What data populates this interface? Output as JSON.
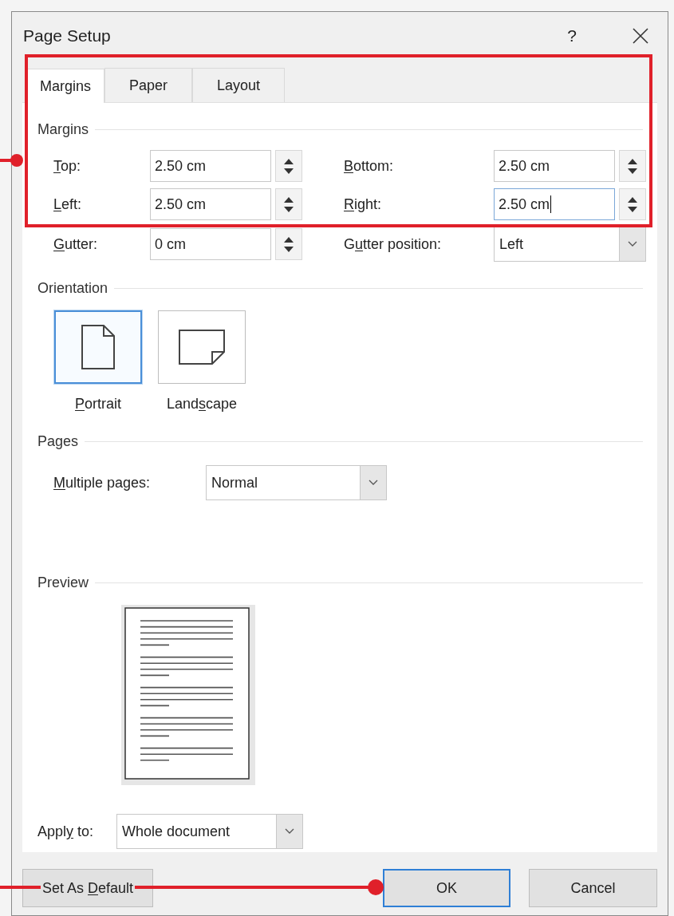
{
  "window": {
    "title": "Page Setup",
    "help": "?"
  },
  "tabs": [
    {
      "label": "Margins",
      "selected": true
    },
    {
      "label": "Paper",
      "selected": false
    },
    {
      "label": "Layout",
      "selected": false
    }
  ],
  "margins": {
    "heading": "Margins",
    "rows": [
      {
        "left": {
          "label": [
            {
              "text": "T",
              "underline": true
            },
            {
              "text": "op:",
              "underline": false
            }
          ],
          "value": "2.50 cm",
          "kind": "spin",
          "focused": false
        },
        "right": {
          "label": [
            {
              "text": "B",
              "underline": true
            },
            {
              "text": "ottom:",
              "underline": false
            }
          ],
          "value": "2.50 cm",
          "kind": "spin",
          "focused": false
        }
      },
      {
        "left": {
          "label": [
            {
              "text": "L",
              "underline": true
            },
            {
              "text": "eft:",
              "underline": false
            }
          ],
          "value": "2.50 cm",
          "kind": "spin",
          "focused": false
        },
        "right": {
          "label": [
            {
              "text": "R",
              "underline": true
            },
            {
              "text": "ight:",
              "underline": false
            }
          ],
          "value": "2.50 cm",
          "kind": "spin",
          "focused": true
        }
      },
      {
        "left": {
          "label": [
            {
              "text": "G",
              "underline": true
            },
            {
              "text": "utter:",
              "underline": false
            }
          ],
          "value": "0 cm",
          "kind": "spin",
          "focused": false
        },
        "right": {
          "label": [
            {
              "text": "G",
              "underline": false
            },
            {
              "text": "u",
              "underline": true
            },
            {
              "text": "tter position:",
              "underline": false
            }
          ],
          "value": "Left",
          "kind": "dropdown",
          "focused": false
        }
      }
    ]
  },
  "orientation": {
    "heading": "Orientation",
    "options": [
      {
        "kind": "portrait",
        "selected": true,
        "label": [
          {
            "text": "P",
            "underline": true
          },
          {
            "text": "ortrait",
            "underline": false
          }
        ]
      },
      {
        "kind": "landscape",
        "selected": false,
        "label": [
          {
            "text": "Land",
            "underline": false
          },
          {
            "text": "s",
            "underline": true
          },
          {
            "text": "cape",
            "underline": false
          }
        ]
      }
    ]
  },
  "pages": {
    "heading": "Pages",
    "label": [
      {
        "text": "M",
        "underline": true
      },
      {
        "text": "ultiple pages:",
        "underline": false
      }
    ],
    "value": "Normal"
  },
  "preview": {
    "heading": "Preview"
  },
  "apply_to": {
    "label": [
      {
        "text": "Appl",
        "underline": false
      },
      {
        "text": "y",
        "underline": true
      },
      {
        "text": " to:",
        "underline": false
      }
    ],
    "value": "Whole document"
  },
  "buttons": [
    {
      "label": [
        {
          "text": "Set As ",
          "underline": false
        },
        {
          "text": "D",
          "underline": true
        },
        {
          "text": "efault",
          "underline": false
        }
      ],
      "default": false
    },
    {
      "label": [
        {
          "text": "OK",
          "underline": false
        }
      ],
      "default": true
    },
    {
      "label": [
        {
          "text": "Cancel",
          "underline": false
        }
      ],
      "default": false
    }
  ]
}
